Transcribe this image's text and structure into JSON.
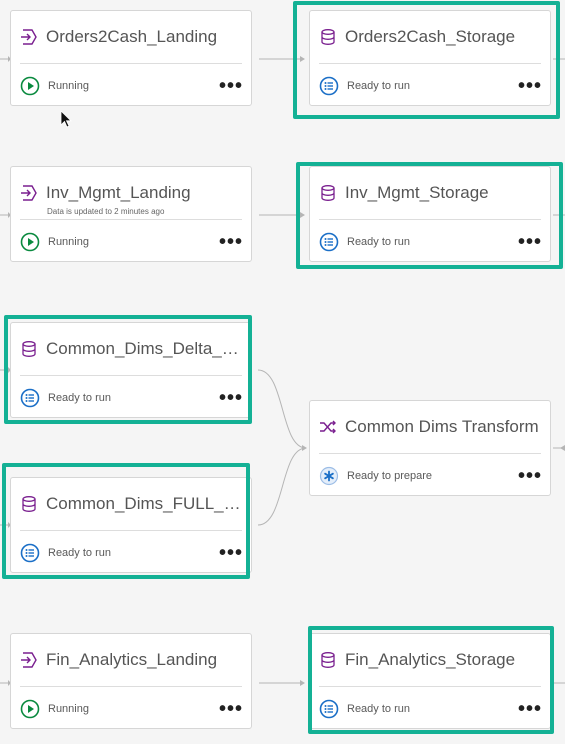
{
  "colors": {
    "accent_highlight": "#14b195",
    "running_green": "#0a8a3f",
    "ready_blue": "#1b6fc7",
    "icon_purple": "#7a1f8f"
  },
  "cards": {
    "c0": {
      "title": "Orders2Cash_Landing",
      "subtitle": "",
      "status": "Running",
      "type_icon": "landing-icon",
      "status_icon": "play-icon",
      "more": "•••"
    },
    "c1": {
      "title": "Orders2Cash_Storage",
      "subtitle": "",
      "status": "Ready to run",
      "type_icon": "database-icon",
      "status_icon": "list-icon",
      "more": "•••"
    },
    "c2": {
      "title": "Inv_Mgmt_Landing",
      "subtitle": "Data is updated to 2 minutes ago",
      "status": "Running",
      "type_icon": "landing-icon",
      "status_icon": "play-icon",
      "more": "•••"
    },
    "c3": {
      "title": "Inv_Mgmt_Storage",
      "subtitle": "",
      "status": "Ready to run",
      "type_icon": "database-icon",
      "status_icon": "list-icon",
      "more": "•••"
    },
    "c4": {
      "title": "Common_Dims_Delta_Storage",
      "subtitle": "",
      "status": "Ready to run",
      "type_icon": "database-icon",
      "status_icon": "list-icon",
      "more": "•••"
    },
    "c5": {
      "title": "Common_Dims_FULL_Storage",
      "subtitle": "",
      "status": "Ready to run",
      "type_icon": "database-icon",
      "status_icon": "list-icon",
      "more": "•••"
    },
    "c6": {
      "title": "Common Dims Transform",
      "subtitle": "",
      "status": "Ready to prepare",
      "type_icon": "transform-icon",
      "status_icon": "asterisk-icon",
      "more": "•••"
    },
    "c7": {
      "title": "Fin_Analytics_Landing",
      "subtitle": "",
      "status": "Running",
      "type_icon": "landing-icon",
      "status_icon": "play-icon",
      "more": "•••"
    },
    "c8": {
      "title": "Fin_Analytics_Storage",
      "subtitle": "",
      "status": "Ready to run",
      "type_icon": "database-icon",
      "status_icon": "list-icon",
      "more": "•••"
    }
  }
}
